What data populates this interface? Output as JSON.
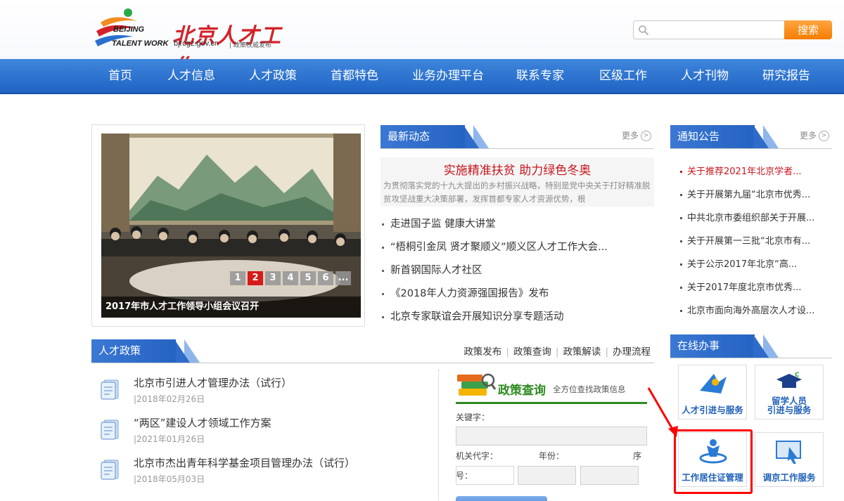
{
  "header": {
    "logo_en_1": "BEIJING",
    "logo_en_2": "TALENT WORK",
    "logo_cn": "北京人才工作",
    "logo_url": "bjrcgz.gov.cn",
    "logo_slogan": "| 政策权威发布",
    "search_placeholder": "",
    "search_button": "搜索"
  },
  "nav": [
    "首页",
    "人才信息",
    "人才政策",
    "首都特色",
    "业务办理平台",
    "联系专家",
    "区级工作",
    "人才刊物",
    "研究报告"
  ],
  "slideshow": {
    "caption": "2017年市人才工作领导小组会议召开",
    "pages": [
      "1",
      "2",
      "3",
      "4",
      "5",
      "6",
      "..."
    ],
    "active_page": "2"
  },
  "news": {
    "title": "最新动态",
    "more": "更多",
    "headline_title": "实施精准扶贫 助力绿色冬奥",
    "headline_summary": "为贯彻落实党的十九大提出的乡村振兴战略，特别是党中央关于打好精准脱贫攻坚战重大决策部署，发挥首都专家人才资源优势，根",
    "items": [
      "走进国子监 健康大讲堂",
      "“梧桐引金凤 贤才聚顺义”顺义区人才工作大会...",
      "新首钢国际人才社区",
      "《2018年人力资源强国报告》发布",
      "北京专家联谊会开展知识分享专题活动"
    ]
  },
  "notice": {
    "title": "通知公告",
    "more": "更多",
    "items": [
      "关于推荐2021年北京学者...",
      "关于开展第九届“北京市优秀...",
      "中共北京市委组织部关于开展...",
      "关于开展第一三批“北京市有...",
      "关于公示2017年北京“高...",
      "关于2017年度北京市优秀...",
      "北京市面向海外高层次人才设..."
    ]
  },
  "policy": {
    "title": "人才政策",
    "links": [
      "政策发布",
      "政策查询",
      "政策解读",
      "办理流程"
    ],
    "items": [
      {
        "title": "北京市引进人才管理办法（试行）",
        "date": "|2018年02月26日"
      },
      {
        "title": "“两区”建设人才领域工作方案",
        "date": "|2021年01月26日"
      },
      {
        "title": "北京市杰出青年科学基金项目管理办法（试行）",
        "date": "|2018年05月03日"
      }
    ]
  },
  "query": {
    "title": "政策查询",
    "subtitle": "全方位查找政策信息",
    "keyword_label": "关键字：",
    "org_label": "机关代字：",
    "year_label": "年份：",
    "seq_label_1": "序",
    "seq_label_2": "号："
  },
  "online": {
    "title": "在线办事",
    "services": [
      {
        "label": "人才引进与服务"
      },
      {
        "label_1": "留学人员",
        "label_2": "引进与服务"
      },
      {
        "label": "工作居住证管理"
      },
      {
        "label": "调京工作服务"
      }
    ]
  },
  "colors": {
    "nav_blue": "#2a70cf",
    "accent_red": "#c7161e",
    "search_orange": "#f7931e",
    "policy_green": "#2e8a20",
    "highlight_red": "#ff0000"
  }
}
